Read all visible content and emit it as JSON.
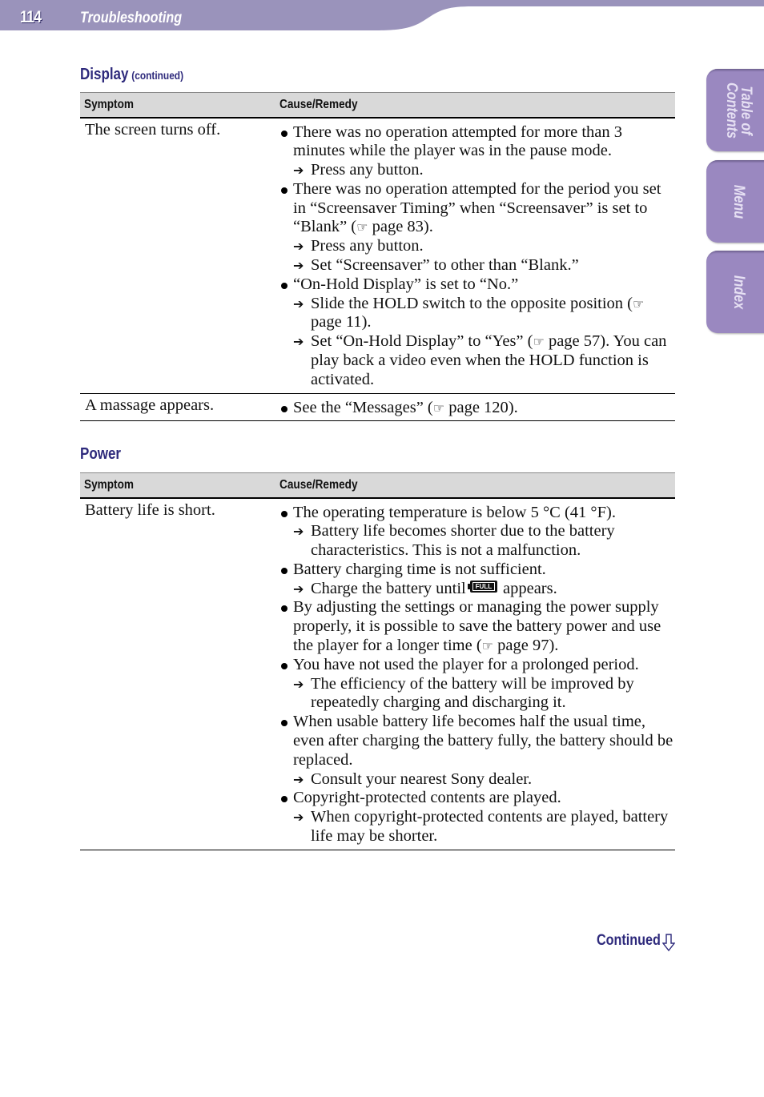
{
  "header": {
    "page_number": "114",
    "section_title": "Troubleshooting",
    "band_color": "#9a93bb"
  },
  "side_tabs": [
    {
      "label": "Table of\nContents",
      "icon": "none"
    },
    {
      "label": "Menu"
    },
    {
      "label": "Index"
    }
  ],
  "display_section": {
    "title": "Display",
    "subtitle": "(continued)",
    "columns": [
      "Symptom",
      "Cause/Remedy"
    ],
    "rows": [
      {
        "symptom": "The screen turns off.",
        "causes": [
          {
            "text": "There was no operation attempted for more than 3 minutes while the player was in the pause mode.",
            "remedies": [
              "Press any button."
            ]
          },
          {
            "text_before_ref": "There was no operation attempted for the period you set in “Screensaver Timing” when “Screensaver” is set to “Blank” (",
            "ref": "page 83",
            "text_after_ref": ").",
            "remedies": [
              "Press any button.",
              "Set “Screensaver” to other than “Blank.”"
            ]
          },
          {
            "text": "“On-Hold Display” is set to “No.”",
            "remedies": [
              {
                "before": "Slide the HOLD switch to the opposite position (",
                "ref": "page 11",
                "after": ")."
              },
              {
                "before": "Set “On-Hold Display” to “Yes” (",
                "ref": "page 57",
                "after": "). You can play back a video even when the HOLD function is activated."
              }
            ]
          }
        ]
      },
      {
        "symptom": "A massage appears.",
        "causes": [
          {
            "before": "See the “Messages” (",
            "ref": "page 120",
            "after": ")."
          }
        ]
      }
    ]
  },
  "power_section": {
    "title": "Power",
    "columns": [
      "Symptom",
      "Cause/Remedy"
    ],
    "rows": [
      {
        "symptom": "Battery life is short.",
        "causes": [
          {
            "text": "The operating temperature is below 5 °C (41 °F).",
            "remedies": [
              "Battery life becomes shorter due to the battery characteristics. This is not a malfunction."
            ]
          },
          {
            "text": "Battery charging time is not sufficient.",
            "remedy_before_icon": "Charge the battery until",
            "icon_label": "FULL",
            "remedy_after_icon": "appears."
          },
          {
            "before": "By adjusting the settings or managing the power supply properly, it is possible to save the battery power and use the player for a longer time (",
            "ref": "page 97",
            "after": ")."
          },
          {
            "text": "You have not used the player for a prolonged period.",
            "remedies": [
              "The efficiency of the battery will be improved by repeatedly charging and discharging it."
            ]
          },
          {
            "text": "When usable battery life becomes half the usual time, even after charging the battery fully, the battery should be replaced.",
            "remedies": [
              "Consult your nearest Sony dealer."
            ]
          },
          {
            "text": "Copyright-protected contents are played.",
            "remedies": [
              "When copyright-protected contents are played, battery life may be shorter."
            ]
          }
        ]
      }
    ]
  },
  "footer": {
    "continued_label": "Continued"
  },
  "colors": {
    "accent": "#2e2a7c",
    "tab": "#9a88c0",
    "table_header": "#d9d9d9"
  }
}
